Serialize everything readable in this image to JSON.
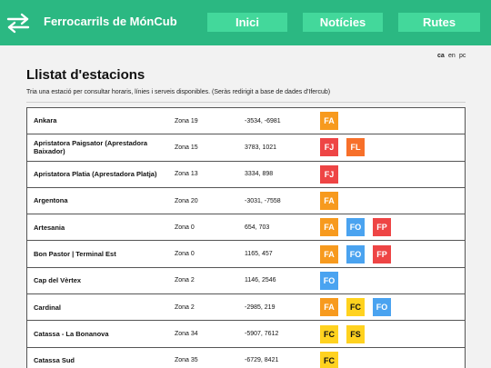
{
  "header": {
    "brand": "Ferrocarrils de MónCub",
    "nav": [
      "Inici",
      "Notícies",
      "Rutes"
    ],
    "color": "#2bb882"
  },
  "languages": [
    "ca",
    "en",
    "pc"
  ],
  "active_language": "ca",
  "page": {
    "title": "Llistat d'estacions",
    "subtitle": "Tria una estació per consultar horaris, línies i serveis disponibles. (Seràs redirigit a base de dades d'Ifercub)"
  },
  "stations": [
    {
      "name": "Ankara",
      "zone": "Zona 19",
      "coords": "-3534, -6981",
      "lines": [
        "FA"
      ]
    },
    {
      "name": "Apristatora Paigsator (Aprestadora Baixador)",
      "zone": "Zona 15",
      "coords": "3783, 1021",
      "lines": [
        "FJ",
        "FL"
      ]
    },
    {
      "name": "Apristatora Platia (Aprestadora Platja)",
      "zone": "Zona 13",
      "coords": "3334, 898",
      "lines": [
        "FJ"
      ]
    },
    {
      "name": "Argentona",
      "zone": "Zona 20",
      "coords": "-3031, -7558",
      "lines": [
        "FA"
      ]
    },
    {
      "name": "Artesania",
      "zone": "Zona 0",
      "coords": "654, 703",
      "lines": [
        "FA",
        "FO",
        "FP"
      ]
    },
    {
      "name": "Bon Pastor | Terminal Est",
      "zone": "Zona 0",
      "coords": "1165, 457",
      "lines": [
        "FA",
        "FO",
        "FP"
      ]
    },
    {
      "name": "Cap del Vèrtex",
      "zone": "Zona 2",
      "coords": "1146, 2546",
      "lines": [
        "FO"
      ]
    },
    {
      "name": "Cardinal",
      "zone": "Zona 2",
      "coords": "-2985, 219",
      "lines": [
        "FA",
        "FC",
        "FO"
      ]
    },
    {
      "name": "Catassa - La Bonanova",
      "zone": "Zona 34",
      "coords": "-5907, 7612",
      "lines": [
        "FC",
        "FS"
      ]
    },
    {
      "name": "Catassa Sud",
      "zone": "Zona 35",
      "coords": "-6729, 8421",
      "lines": [
        "FC"
      ]
    }
  ]
}
